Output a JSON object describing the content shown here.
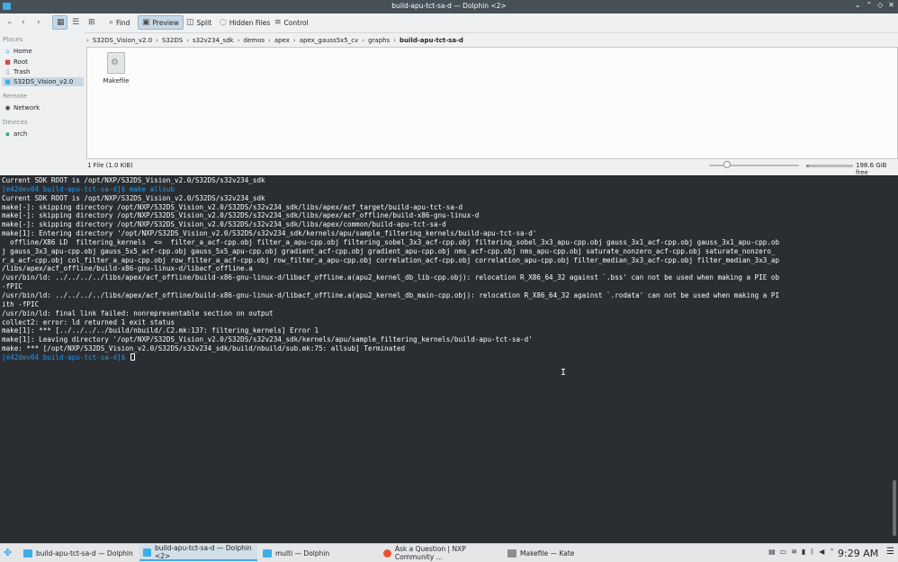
{
  "window": {
    "title": "build-apu-tct-sa-d — Dolphin <2>",
    "controls": [
      "⌄",
      "⌃",
      "◇",
      "✕"
    ]
  },
  "toolbar": {
    "back": "‹",
    "forward": "›",
    "up": "‹",
    "find": "Find",
    "preview": "Preview",
    "split": "Split",
    "hidden_files": "Hidden Files",
    "control": "Control"
  },
  "places": {
    "places_header": "Places",
    "items": [
      "Home",
      "Root",
      "Trash",
      "S32DS_Vision_v2.0"
    ],
    "remote_header": "Remote",
    "remote_items": [
      "Network"
    ],
    "devices_header": "Devices",
    "device_items": [
      "arch"
    ]
  },
  "breadcrumb": [
    "S32DS_Vision_v2.0",
    "S32DS",
    "s32v234_sdk",
    "demos",
    "apex",
    "apex_gauss5x5_cv",
    "graphs",
    "build-apu-tct-sa-d"
  ],
  "files": [
    {
      "name": "Makefile",
      "icon": "makefile-icon"
    }
  ],
  "statusbar": {
    "summary": "1 File (1.0 KiB)",
    "zoom_level": 0.2,
    "disk_used_fraction": 0.05,
    "free_space": "198.6 GiB free"
  },
  "terminal": {
    "lines": [
      {
        "text": "Current SDK ROOT is /opt/NXP/S32DS_Vision_v2.0/S32DS/s32v234_sdk",
        "kind": "out"
      },
      {
        "text": "[e42dev04 build-apu-tct-sa-d]$ make allsub",
        "kind": "prompt"
      },
      {
        "text": "Current SDK ROOT is /opt/NXP/S32DS_Vision_v2.0/S32DS/s32v234_sdk",
        "kind": "out"
      },
      {
        "text": "make[-]: skipping directory /opt/NXP/S32DS_Vision_v2.0/S32DS/s32v234_sdk/libs/apex/acf_target/build-apu-tct-sa-d",
        "kind": "out"
      },
      {
        "text": "make[-]: skipping directory /opt/NXP/S32DS_Vision_v2.0/S32DS/s32v234_sdk/libs/apex/acf_offline/build-x86-gnu-linux-d",
        "kind": "out"
      },
      {
        "text": "make[-]: skipping directory /opt/NXP/S32DS_Vision_v2.0/S32DS/s32v234_sdk/libs/apex/common/build-apu-tct-sa-d",
        "kind": "out"
      },
      {
        "text": "make[1]: Entering directory '/opt/NXP/S32DS_Vision_v2.0/S32DS/s32v234_sdk/kernels/apu/sample_filtering_kernels/build-apu-tct-sa-d'",
        "kind": "out"
      },
      {
        "text": "  offline/X86 LD  filtering_kernels  <=  filter_a_acf-cpp.obj filter_a_apu-cpp.obj filtering_sobel_3x3_acf-cpp.obj filtering_sobel_3x3_apu-cpp.obj gauss_3x1_acf-cpp.obj gauss_3x1_apu-cpp.ob",
        "kind": "out"
      },
      {
        "text": "j gauss_3x3_apu-cpp.obj gauss_5x5_acf-cpp.obj gauss_5x5_apu-cpp.obj gradient_acf-cpp.obj gradient_apu-cpp.obj nms_acf-cpp.obj nms_apu-cpp.obj saturate_nonzero_acf-cpp.obj saturate_nonzero_",
        "kind": "out"
      },
      {
        "text": "r_a_acf-cpp.obj col_filter_a_apu-cpp.obj row_filter_a_acf-cpp.obj row_filter_a_apu-cpp.obj correlation_acf-cpp.obj correlation_apu-cpp.obj filter_median_3x3_acf-cpp.obj filter_median_3x3_ap",
        "kind": "out"
      },
      {
        "text": "/libs/apex/acf_offline/build-x86-gnu-linux-d/libacf_offline.a",
        "kind": "out"
      },
      {
        "text": "/usr/bin/ld: ../../../../libs/apex/acf_offline/build-x86-gnu-linux-d/libacf_offline.a(apu2_kernel_db_lib-cpp.obj): relocation R_X86_64_32 against `.bss' can not be used when making a PIE ob",
        "kind": "out"
      },
      {
        "text": "-fPIC",
        "kind": "out"
      },
      {
        "text": "/usr/bin/ld: ../../../../libs/apex/acf_offline/build-x86-gnu-linux-d/libacf_offline.a(apu2_kernel_db_main-cpp.obj): relocation R_X86_64_32 against `.rodata' can not be used when making a PI",
        "kind": "out"
      },
      {
        "text": "ith -fPIC",
        "kind": "out"
      },
      {
        "text": "/usr/bin/ld: final link failed: nonrepresentable section on output",
        "kind": "out"
      },
      {
        "text": "collect2: error: ld returned 1 exit status",
        "kind": "out"
      },
      {
        "text": "make[1]: *** [../../../../build/nbuild/.C2.mk:137: filtering_kernels] Error 1",
        "kind": "out"
      },
      {
        "text": "make[1]: Leaving directory '/opt/NXP/S32DS_Vision_v2.0/S32DS/s32v234_sdk/kernels/apu/sample_filtering_kernels/build-apu-tct-sa-d'",
        "kind": "out"
      },
      {
        "text": "make: *** [/opt/NXP/S32DS_Vision_v2.0/S32DS/s32v234_sdk/build/nbuild/sub.mk:75: allsub] Terminated",
        "kind": "out"
      },
      {
        "text": "[e42dev04 build-apu-tct-sa-d]$ ",
        "kind": "prompt-cursor"
      }
    ]
  },
  "taskbar": {
    "tasks": [
      {
        "label": "build-apu-tct-sa-d — Dolphin",
        "active": false,
        "icon_color": "#3daee9"
      },
      {
        "label": "build-apu-tct-sa-d — Dolphin <2>",
        "active": true,
        "icon_color": "#3daee9"
      },
      {
        "label": "multi — Dolphin",
        "active": false,
        "icon_color": "#3daee9"
      },
      {
        "label": "Ask a Question | NXP Community ...",
        "active": false,
        "icon_color": "#e8532f"
      },
      {
        "label": "Makefile — Kate",
        "active": false,
        "icon_color": "#8c8f91"
      }
    ],
    "clock": "9:29 AM"
  },
  "colors": {
    "accent": "#3daee9",
    "terminal_bg": "#2a2e32",
    "prompt": "#1d99f3"
  }
}
